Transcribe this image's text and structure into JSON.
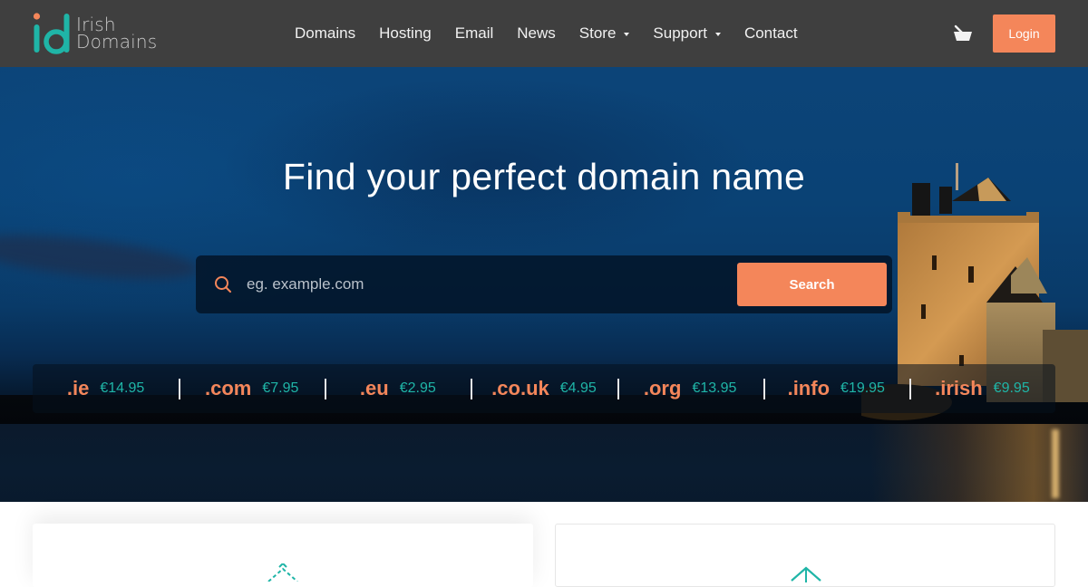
{
  "brand": {
    "name_line1": "Irish",
    "name_line2": "Domains",
    "mark": "id",
    "colors": {
      "teal": "#1fb5a7",
      "orange": "#f4865a",
      "header_bg": "#3f3f3f"
    }
  },
  "nav": {
    "items": [
      {
        "label": "Domains",
        "has_dropdown": false
      },
      {
        "label": "Hosting",
        "has_dropdown": false
      },
      {
        "label": "Email",
        "has_dropdown": false
      },
      {
        "label": "News",
        "has_dropdown": false
      },
      {
        "label": "Store",
        "has_dropdown": true
      },
      {
        "label": "Support",
        "has_dropdown": true
      },
      {
        "label": "Contact",
        "has_dropdown": false
      }
    ],
    "cart_icon": "basket-icon",
    "login_label": "Login"
  },
  "hero": {
    "title": "Find your perfect domain name",
    "search": {
      "placeholder": "eg. example.com",
      "value": "",
      "button_label": "Search",
      "icon": "search-icon"
    },
    "tlds": [
      {
        "name": ".ie",
        "price": "€14.95"
      },
      {
        "name": ".com",
        "price": "€7.95"
      },
      {
        "name": ".eu",
        "price": "€2.95"
      },
      {
        "name": ".co.uk",
        "price": "€4.95"
      },
      {
        "name": ".org",
        "price": "€13.95"
      },
      {
        "name": ".info",
        "price": "€19.95"
      },
      {
        "name": ".irish",
        "price": "€9.95"
      }
    ]
  },
  "cards": [
    {
      "icon": "house-icon"
    },
    {
      "icon": "house-icon"
    }
  ]
}
